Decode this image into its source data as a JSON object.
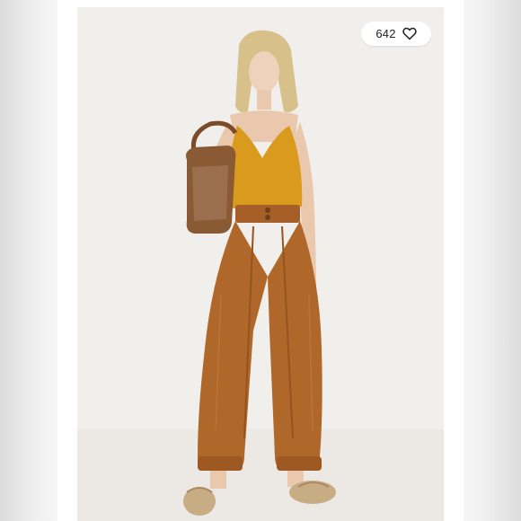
{
  "listing": {
    "like_count": "642"
  },
  "icons": {
    "like": "heart-outline-icon"
  },
  "colors": {
    "photo_background": "#f1efeb",
    "top": "#d99a1e",
    "pants": "#b0672a",
    "bag": "#8a5a35"
  }
}
